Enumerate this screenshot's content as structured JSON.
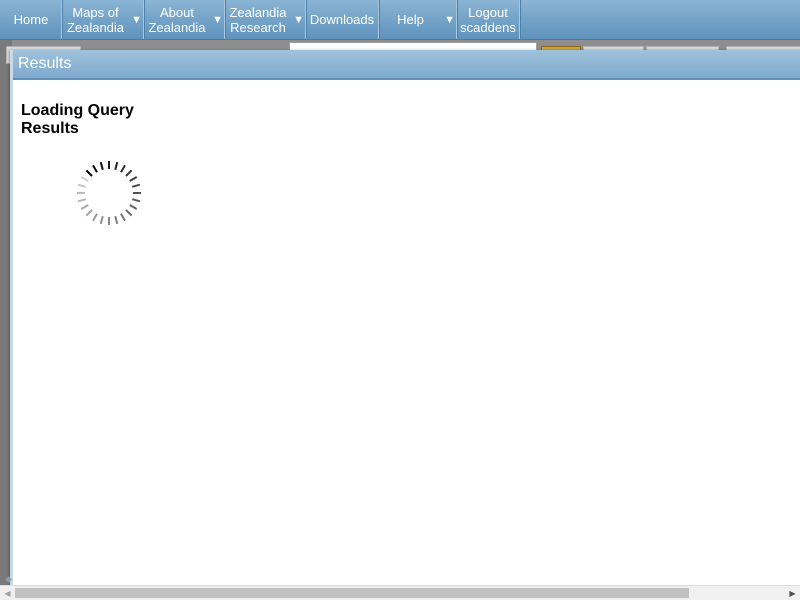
{
  "nav": {
    "home": "Home",
    "maps": "Maps of\nZealandia",
    "about": "About\nZealandia",
    "research": "Zealandia\nResearch",
    "downloads": "Downloads",
    "help": "Help",
    "logout": "Logout\nscaddens",
    "dropdown_glyph": "▼"
  },
  "dialog": {
    "title": "Results",
    "loading_text": "Loading Query Results"
  },
  "scrollbar": {
    "left_arrow": "◀",
    "right_arrow": "▶"
  },
  "colors": {
    "nav_bg": "#6f9fc6",
    "dialog_title_bg": "#8db5d5",
    "spinner": "#000000"
  }
}
